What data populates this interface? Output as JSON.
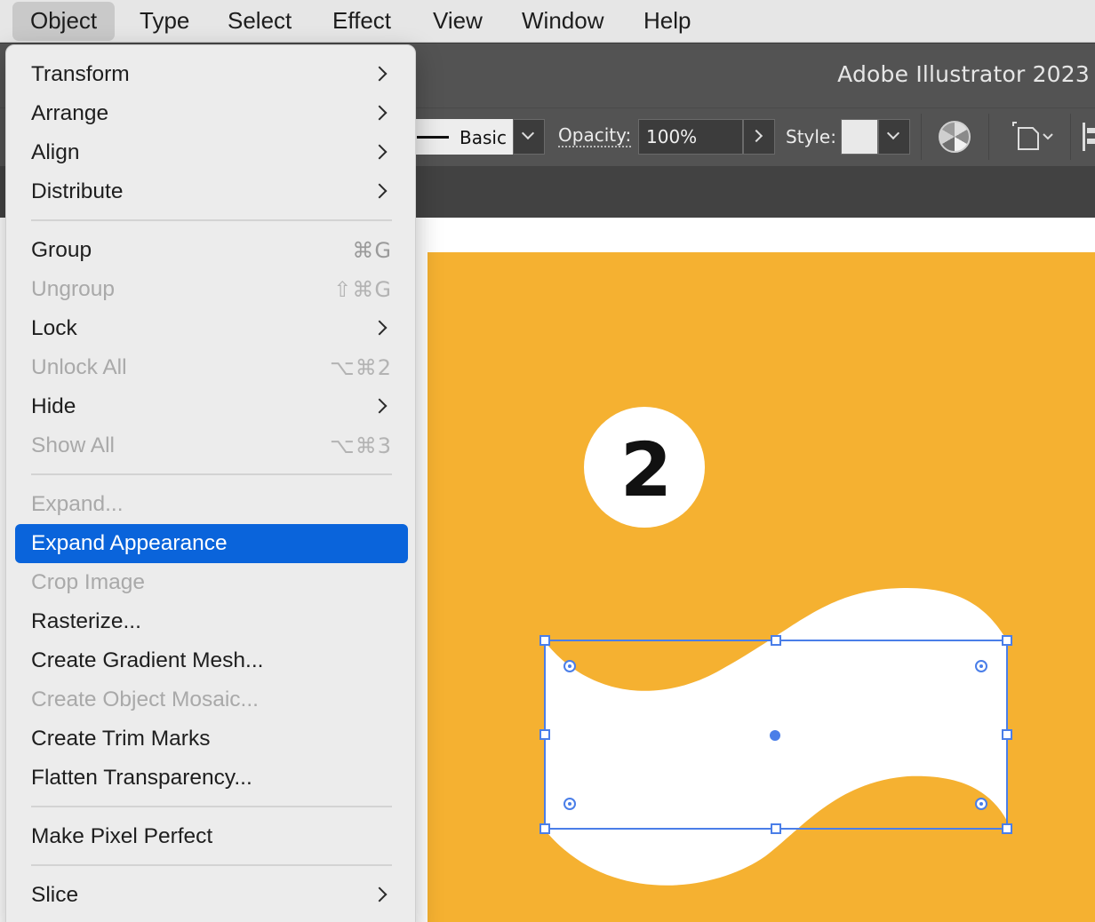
{
  "menubar": {
    "items": [
      "Object",
      "Type",
      "Select",
      "Effect",
      "View",
      "Window",
      "Help"
    ],
    "active": "Object"
  },
  "app": {
    "title": "Adobe Illustrator 2023"
  },
  "controlbar": {
    "brush_label": "Basic",
    "opacity_label": "Opacity:",
    "opacity_value": "100%",
    "style_label": "Style:"
  },
  "artboard": {
    "step_number": "2",
    "background_color": "#f5b131",
    "selection_color": "#4a7ee8"
  },
  "object_menu": {
    "items": [
      {
        "label": "Transform",
        "shortcut": "",
        "submenu": true,
        "enabled": true
      },
      {
        "label": "Arrange",
        "shortcut": "",
        "submenu": true,
        "enabled": true
      },
      {
        "label": "Align",
        "shortcut": "",
        "submenu": true,
        "enabled": true
      },
      {
        "label": "Distribute",
        "shortcut": "",
        "submenu": true,
        "enabled": true
      },
      {
        "label": "Group",
        "shortcut": "⌘G",
        "submenu": false,
        "enabled": true
      },
      {
        "label": "Ungroup",
        "shortcut": "⇧⌘G",
        "submenu": false,
        "enabled": false
      },
      {
        "label": "Lock",
        "shortcut": "",
        "submenu": true,
        "enabled": true
      },
      {
        "label": "Unlock All",
        "shortcut": "⌥⌘2",
        "submenu": false,
        "enabled": false
      },
      {
        "label": "Hide",
        "shortcut": "",
        "submenu": true,
        "enabled": true
      },
      {
        "label": "Show All",
        "shortcut": "⌥⌘3",
        "submenu": false,
        "enabled": false
      },
      {
        "label": "Expand...",
        "shortcut": "",
        "submenu": false,
        "enabled": false
      },
      {
        "label": "Expand Appearance",
        "shortcut": "",
        "submenu": false,
        "enabled": true,
        "highlighted": true
      },
      {
        "label": "Crop Image",
        "shortcut": "",
        "submenu": false,
        "enabled": false
      },
      {
        "label": "Rasterize...",
        "shortcut": "",
        "submenu": false,
        "enabled": true
      },
      {
        "label": "Create Gradient Mesh...",
        "shortcut": "",
        "submenu": false,
        "enabled": true
      },
      {
        "label": "Create Object Mosaic...",
        "shortcut": "",
        "submenu": false,
        "enabled": false
      },
      {
        "label": "Create Trim Marks",
        "shortcut": "",
        "submenu": false,
        "enabled": true
      },
      {
        "label": "Flatten Transparency...",
        "shortcut": "",
        "submenu": false,
        "enabled": true
      },
      {
        "label": "Make Pixel Perfect",
        "shortcut": "",
        "submenu": false,
        "enabled": true
      },
      {
        "label": "Slice",
        "shortcut": "",
        "submenu": true,
        "enabled": true
      }
    ]
  },
  "colors": {
    "highlight": "#0a64db",
    "menu_bg": "#ececec",
    "disabled_text": "#a9a9a9"
  }
}
